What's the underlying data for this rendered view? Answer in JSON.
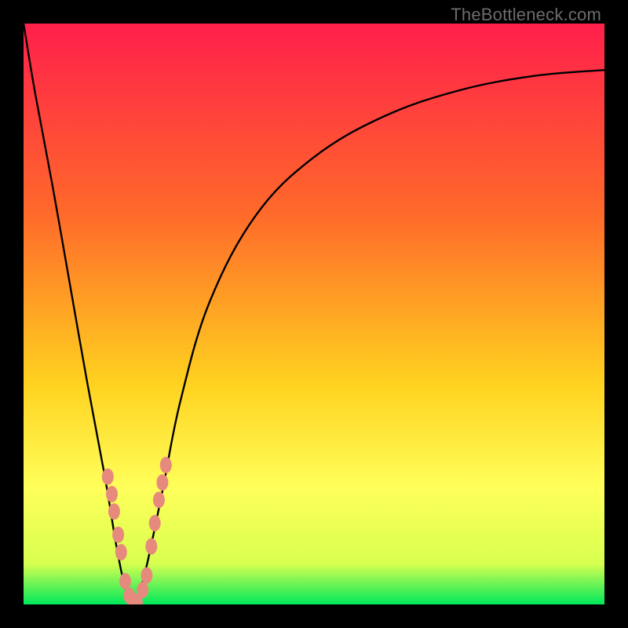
{
  "watermark": {
    "text": "TheBottleneck.com"
  },
  "colors": {
    "bg_black": "#000000",
    "grad_top": "#ff1f4b",
    "grad_mid1": "#ff6a2a",
    "grad_mid2": "#ffd21f",
    "grad_mid3": "#ffff5a",
    "grad_mid4": "#d7ff4f",
    "grad_bottom": "#00e85b",
    "curve": "#000000",
    "marker": "#e78a7e"
  },
  "chart_data": {
    "type": "line",
    "title": "",
    "xlabel": "",
    "ylabel": "",
    "xlim": [
      0,
      100
    ],
    "ylim": [
      0,
      100
    ],
    "series": [
      {
        "name": "bottleneck-curve",
        "x": [
          0,
          2,
          5,
          8,
          11,
          14,
          16,
          17.5,
          19,
          20,
          21.5,
          24,
          27,
          32,
          40,
          50,
          62,
          75,
          88,
          100
        ],
        "y": [
          100,
          88,
          72,
          55,
          38,
          22,
          10,
          3,
          0,
          2,
          8,
          20,
          35,
          52,
          67,
          77,
          84,
          88.5,
          91,
          92
        ]
      }
    ],
    "markers": {
      "name": "highlight-points",
      "x": [
        14.5,
        15.2,
        15.6,
        16.3,
        16.8,
        17.5,
        18.2,
        18.8,
        19.5,
        20.5,
        21.2,
        22.0,
        22.6,
        23.3,
        23.9,
        24.5
      ],
      "y": [
        22,
        19,
        16,
        12,
        9,
        4,
        1.5,
        0.7,
        0.4,
        2.5,
        5,
        10,
        14,
        18,
        21,
        24
      ]
    }
  }
}
